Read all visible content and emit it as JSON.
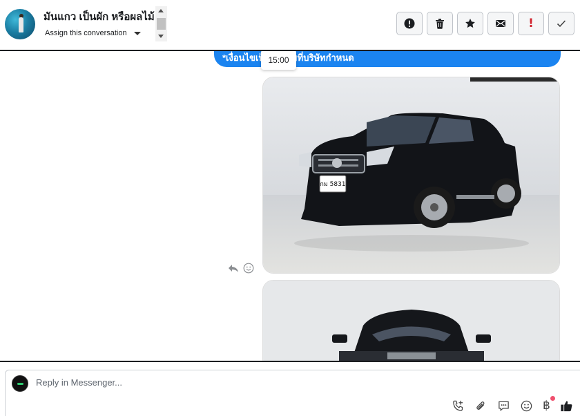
{
  "header": {
    "contact_name": "มันแกว เป็นผัก หรือผลไม้",
    "assign_label": "Assign this conversation",
    "actions": [
      {
        "name": "mark-spam-button",
        "icon": "alert-circle-icon"
      },
      {
        "name": "delete-button",
        "icon": "trash-icon"
      },
      {
        "name": "star-button",
        "icon": "star-icon"
      },
      {
        "name": "mark-unread-button",
        "icon": "envelope-icon"
      },
      {
        "name": "follow-up-button",
        "icon": "exclamation-icon",
        "label": "!"
      },
      {
        "name": "mark-done-button",
        "icon": "checkmark-icon"
      }
    ]
  },
  "chat": {
    "message_text": "*เงื่อนไขเป็นไปตามที่บริษัทกำหนด",
    "time_tooltip": "15:00",
    "attachments": [
      {
        "type": "image",
        "subject": "black pickup truck",
        "plate_text": "กม 5831"
      },
      {
        "type": "image",
        "subject": "black pickup truck front view"
      }
    ]
  },
  "composer": {
    "placeholder": "Reply in Messenger...",
    "tools": [
      "add-call-icon",
      "paperclip-icon",
      "chat-bubble-icon",
      "emoji-icon",
      "baht-icon",
      "thumbs-up-icon"
    ],
    "baht_symbol": "฿"
  },
  "colors": {
    "bubble": "#1b84f0",
    "accent_red": "#d1242f",
    "notification_dot": "#f0506e"
  }
}
